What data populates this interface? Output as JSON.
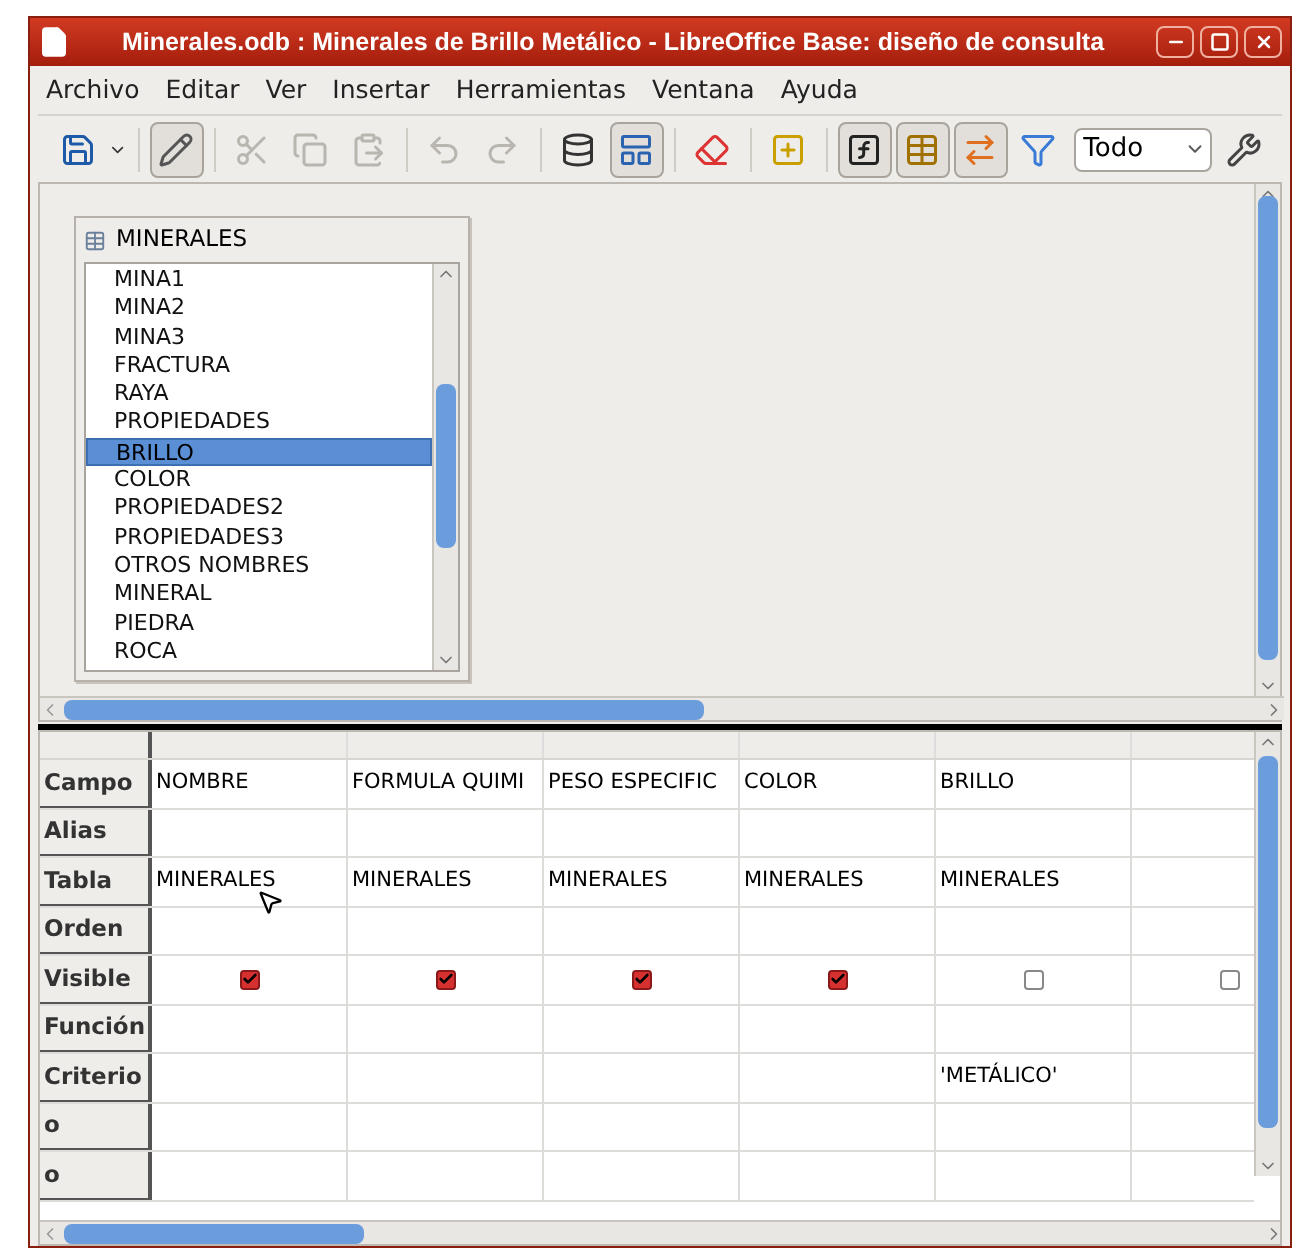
{
  "window": {
    "title": "Minerales.odb : Minerales de Brillo Metálico - LibreOffice Base: diseño de consulta"
  },
  "menu": [
    "Archivo",
    "Editar",
    "Ver",
    "Insertar",
    "Herramientas",
    "Ventana",
    "Ayuda"
  ],
  "toolbar": {
    "buttons": [
      {
        "kind": "save",
        "pressed": false,
        "disabled": false
      },
      {
        "kind": "edit",
        "pressed": true,
        "disabled": false
      },
      {
        "kind": "cut",
        "pressed": false,
        "disabled": true
      },
      {
        "kind": "copy",
        "pressed": false,
        "disabled": true
      },
      {
        "kind": "paste",
        "pressed": false,
        "disabled": true
      },
      {
        "kind": "undo",
        "pressed": false,
        "disabled": true
      },
      {
        "kind": "redo",
        "pressed": false,
        "disabled": true
      },
      {
        "kind": "run",
        "pressed": false,
        "disabled": false
      },
      {
        "kind": "design",
        "pressed": true,
        "disabled": false
      },
      {
        "kind": "clear",
        "pressed": false,
        "disabled": false
      },
      {
        "kind": "addtable",
        "pressed": false,
        "disabled": false
      },
      {
        "kind": "functions",
        "pressed": true,
        "disabled": false
      },
      {
        "kind": "tablenames",
        "pressed": true,
        "disabled": false
      },
      {
        "kind": "alias",
        "pressed": true,
        "disabled": false
      },
      {
        "kind": "distinct",
        "pressed": false,
        "disabled": false
      },
      {
        "kind": "sql",
        "pressed": false,
        "disabled": false
      }
    ],
    "limit": "Todo"
  },
  "table_window": {
    "title": "MINERALES",
    "fields": [
      {
        "name": "MINA1",
        "selected": false
      },
      {
        "name": "MINA2",
        "selected": false
      },
      {
        "name": "MINA3",
        "selected": false
      },
      {
        "name": "FRACTURA",
        "selected": false
      },
      {
        "name": "RAYA",
        "selected": false
      },
      {
        "name": "PROPIEDADES",
        "selected": false
      },
      {
        "name": "BRILLO",
        "selected": true
      },
      {
        "name": "COLOR",
        "selected": false
      },
      {
        "name": "PROPIEDADES2",
        "selected": false
      },
      {
        "name": "PROPIEDADES3",
        "selected": false
      },
      {
        "name": "OTROS NOMBRES",
        "selected": false
      },
      {
        "name": "MINERAL",
        "selected": false
      },
      {
        "name": "PIEDRA",
        "selected": false
      },
      {
        "name": "ROCA",
        "selected": false
      }
    ]
  },
  "grid": {
    "row_labels": [
      "Campo",
      "Alias",
      "Tabla",
      "Orden",
      "Visible",
      "Función",
      "Criterio",
      "o",
      "o"
    ],
    "columns": [
      {
        "campo": "NOMBRE",
        "tabla": "MINERALES",
        "visible": true
      },
      {
        "campo": "FORMULA QUIMI",
        "tabla": "MINERALES",
        "visible": true
      },
      {
        "campo": "PESO ESPECIFIC",
        "tabla": "MINERALES",
        "visible": true
      },
      {
        "campo": "COLOR",
        "tabla": "MINERALES",
        "visible": true
      },
      {
        "campo": "BRILLO",
        "tabla": "MINERALES",
        "visible": false,
        "criterio": "'METÁLICO'"
      },
      {
        "visible": false
      }
    ]
  }
}
